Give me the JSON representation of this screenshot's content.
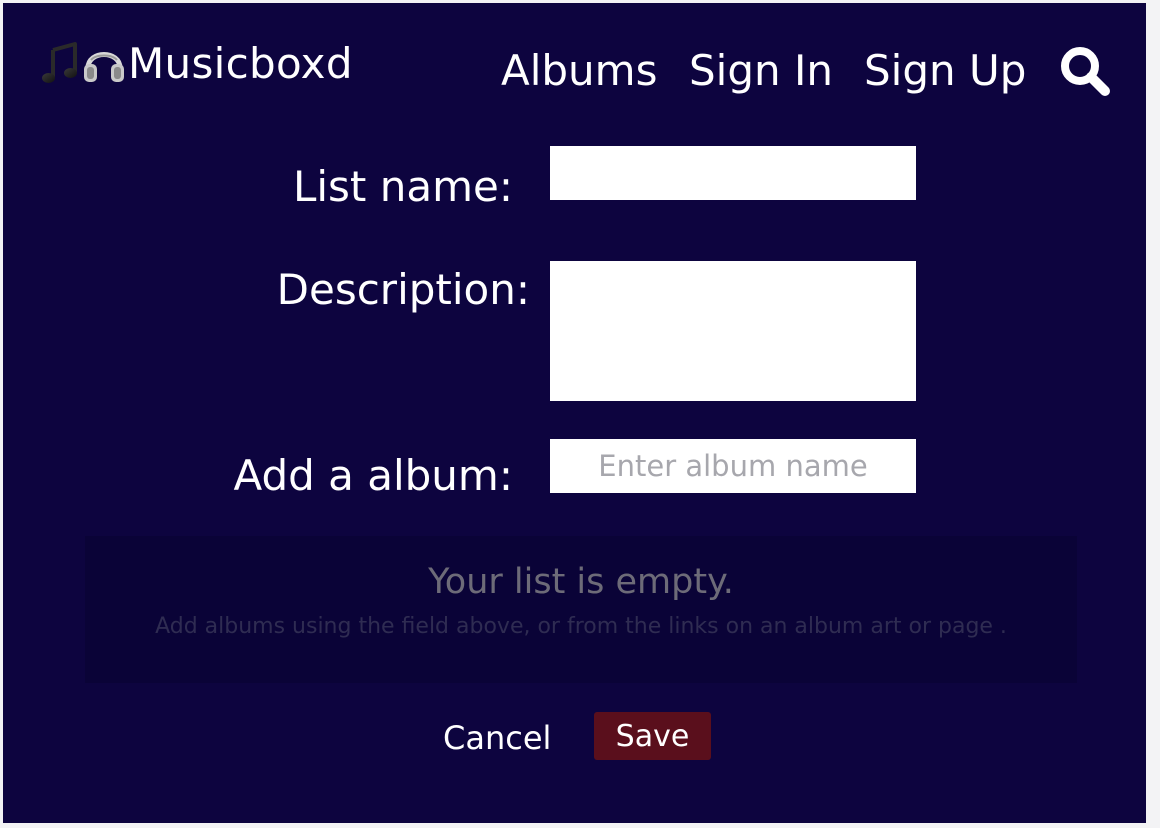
{
  "header": {
    "logo_text": "Musicboxd",
    "logo_icons": [
      "music-note-icon",
      "headphones-icon"
    ],
    "nav": {
      "albums": "Albums",
      "sign_in": "Sign In",
      "sign_up": "Sign Up"
    },
    "search_icon": "search-icon"
  },
  "form": {
    "list_name_label": "List name:",
    "list_name_value": "",
    "description_label": "Description:",
    "description_value": "",
    "add_album_label": "Add a album:",
    "add_album_placeholder": "Enter album name",
    "add_album_value": ""
  },
  "empty_state": {
    "title": "Your list is empty.",
    "subtitle": "Add albums using the field above, or from the links on an album art or page ."
  },
  "actions": {
    "cancel": "Cancel",
    "save": "Save"
  },
  "colors": {
    "background": "#0d043f",
    "panel": "#0a0337",
    "save_button": "#5a0f1c",
    "text": "#ffffff"
  }
}
